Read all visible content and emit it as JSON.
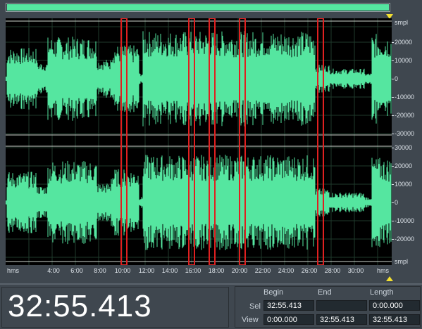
{
  "overview": {
    "fill_fraction": 1.0
  },
  "waveform": {
    "unit_label": "smpl",
    "top_ticks": [
      "20000",
      "10000",
      "0",
      "-10000",
      "-20000",
      "-30000"
    ],
    "bottom_ticks": [
      "30000",
      "20000",
      "10000",
      "0",
      "-10000",
      "-20000"
    ],
    "bottom_unit_label": "smpl",
    "wave_color": "#55e6a0",
    "selection_color": "#e02020"
  },
  "timeline": {
    "start_label": "hms",
    "end_label": "hms",
    "labels": [
      "4:00",
      "6:00",
      "8:00",
      "10:00",
      "12:00",
      "14:00",
      "16:00",
      "18:00",
      "20:00",
      "22:00",
      "24:00",
      "26:00",
      "28:00",
      "30:00"
    ]
  },
  "time_display": {
    "value": "32:55.413"
  },
  "selection_panel": {
    "columns": {
      "begin": "Begin",
      "end": "End",
      "length": "Length"
    },
    "sel": {
      "label": "Sel",
      "begin": "32:55.413",
      "end": "",
      "length": "0:00.000"
    },
    "view": {
      "label": "View",
      "begin": "0:00.000",
      "end": "32:55.413",
      "length": "32:55.413"
    }
  },
  "colors": {
    "background": "#3f474f",
    "wave": "#55e6a0",
    "marker": "#f3e030"
  }
}
